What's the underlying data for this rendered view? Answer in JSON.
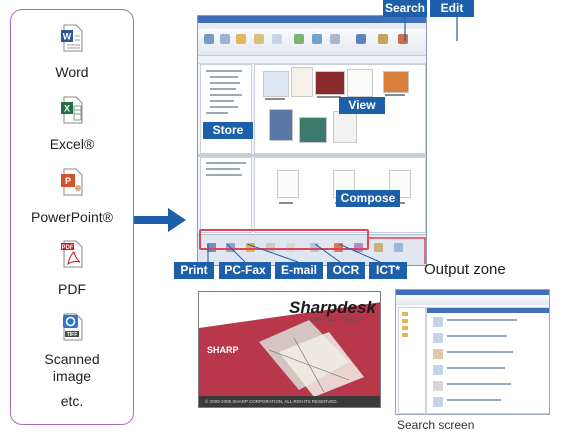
{
  "file_types": [
    {
      "label": "Word",
      "icon": "word-document-icon",
      "color": "#2b579a"
    },
    {
      "label": "Excel®",
      "icon": "excel-spreadsheet-icon",
      "color": "#1f7244"
    },
    {
      "label": "PowerPoint®",
      "icon": "powerpoint-document-icon",
      "color": "#d2532a"
    },
    {
      "label": "PDF",
      "icon": "pdf-document-icon",
      "color": "#c4161c",
      "icon_text": "PDF"
    },
    {
      "label": "Scanned image",
      "label_lines": [
        "Scanned",
        "image"
      ],
      "icon": "tiff-image-icon",
      "color": "#2f78c4",
      "icon_text": "TIFF"
    },
    {
      "label": "etc.",
      "icon": null
    }
  ],
  "callouts": {
    "search": "Search",
    "edit": "Edit",
    "view": "View",
    "store": "Store",
    "compose": "Compose",
    "output_functions": [
      "Print",
      "PC-Fax",
      "E-mail",
      "OCR",
      "ICT*"
    ],
    "output_zone": "Output zone"
  },
  "splash": {
    "title": "Sharpdesk",
    "subtitle": "SHARP CORPORATION",
    "brand": "SHARP",
    "copyright": "© 2000-2005 SHARP CORPORATION, ALL RIGHTS RESERVED."
  },
  "search_screen_caption": "Search screen",
  "colors": {
    "callout_blue": "#1d5fa8",
    "output_zone_red": "#e0455e",
    "panel_border": "#b06ab3",
    "arrow": "#1d5fa8"
  }
}
